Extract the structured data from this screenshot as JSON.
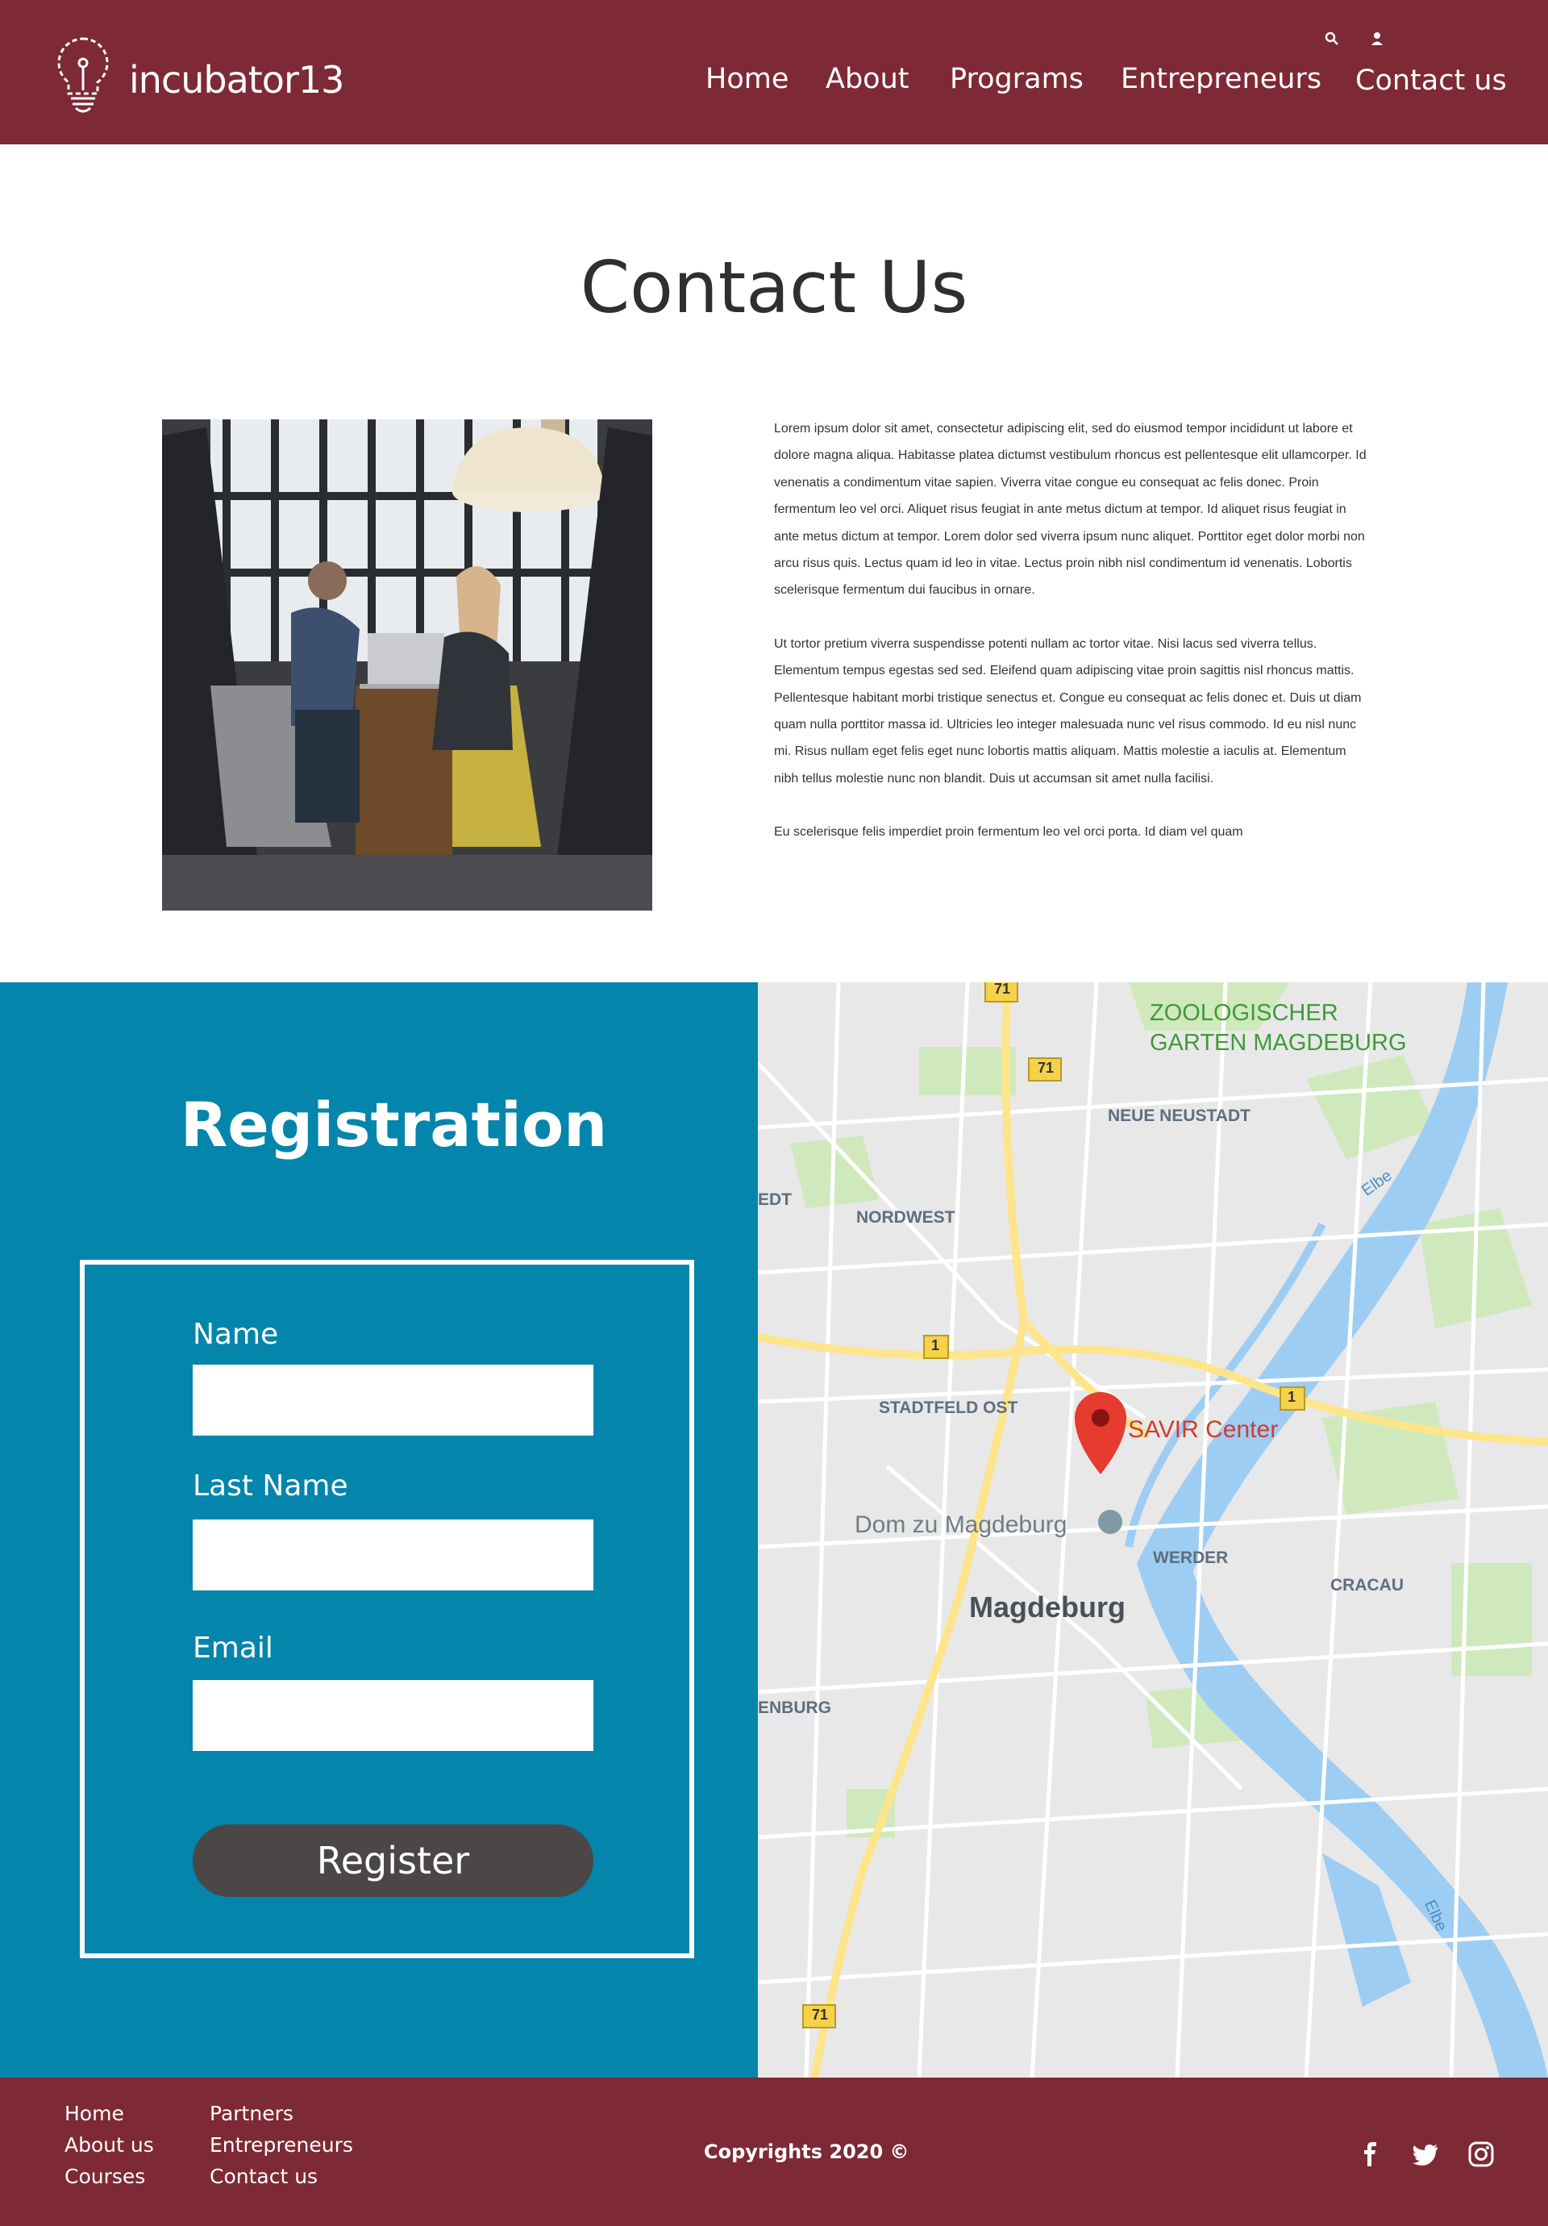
{
  "header": {
    "logo_text": "incubator13",
    "nav": [
      "Home",
      "About",
      "Programs",
      "Entrepreneurs",
      "Contact us"
    ],
    "icons": [
      "search-icon",
      "user-icon"
    ]
  },
  "contact": {
    "title": "Contact Us",
    "paragraphs": [
      "Lorem ipsum dolor sit amet, consectetur adipiscing elit, sed do eiusmod tempor incididunt ut labore et dolore magna aliqua. Habitasse platea dictumst vestibulum rhoncus est pellentesque elit ullamcorper. Id venenatis a condimentum vitae sapien. Viverra vitae congue eu consequat ac felis donec. Proin fermentum leo vel orci. Aliquet risus feugiat in ante metus dictum at tempor. Id aliquet risus feugiat in ante metus dictum at tempor. Lorem dolor sed viverra ipsum nunc aliquet. Porttitor eget dolor morbi non arcu risus quis. Lectus quam id leo in vitae. Lectus proin nibh nisl condimentum id venenatis. Lobortis scelerisque fermentum dui faucibus in ornare.",
      "Ut tortor pretium viverra suspendisse potenti nullam ac tortor vitae. Nisi lacus sed viverra tellus. Elementum tempus egestas sed sed. Eleifend quam adipiscing vitae proin sagittis nisl rhoncus mattis. Pellentesque habitant morbi tristique senectus et. Congue eu consequat ac felis donec et. Duis ut diam quam nulla porttitor massa id. Ultricies leo integer malesuada nunc vel risus commodo. Id eu nisl nunc mi. Risus nullam eget felis eget nunc lobortis mattis aliquam. Mattis molestie a iaculis at. Elementum nibh tellus molestie nunc non blandit. Duis ut accumsan sit amet nulla facilisi.",
      "Eu scelerisque felis imperdiet proin fermentum leo vel orci porta. Id diam vel quam"
    ]
  },
  "registration": {
    "title": "Registration",
    "fields": [
      {
        "label": "Name",
        "value": ""
      },
      {
        "label": "Last Name",
        "value": ""
      },
      {
        "label": "Email",
        "value": ""
      }
    ],
    "button": "Register"
  },
  "map": {
    "labels": {
      "zoo": "ZOOLOGISCHER\nGARTEN MAGDEBURG",
      "neue_neustadt": "NEUE NEUSTADT",
      "nordwest": "NORDWEST",
      "edt": "EDT",
      "stadtfeld_ost": "STADTFELD OST",
      "marker": "SAVIR Center",
      "dom": "Dom zu Magdeburg",
      "werder": "WERDER",
      "cracau": "CRACAU",
      "city": "Magdeburg",
      "enburg": "ENBURG",
      "elbe": "Elbe"
    },
    "road_badges": [
      "71",
      "71",
      "1",
      "1",
      "71"
    ]
  },
  "footer": {
    "col1": [
      "Home",
      "About us",
      "Courses"
    ],
    "col2": [
      "Partners",
      "Entrepreneurs",
      "Contact us"
    ],
    "copyright": "Copyrights 2020 ©",
    "social": [
      "facebook-icon",
      "twitter-icon",
      "instagram-icon"
    ]
  }
}
